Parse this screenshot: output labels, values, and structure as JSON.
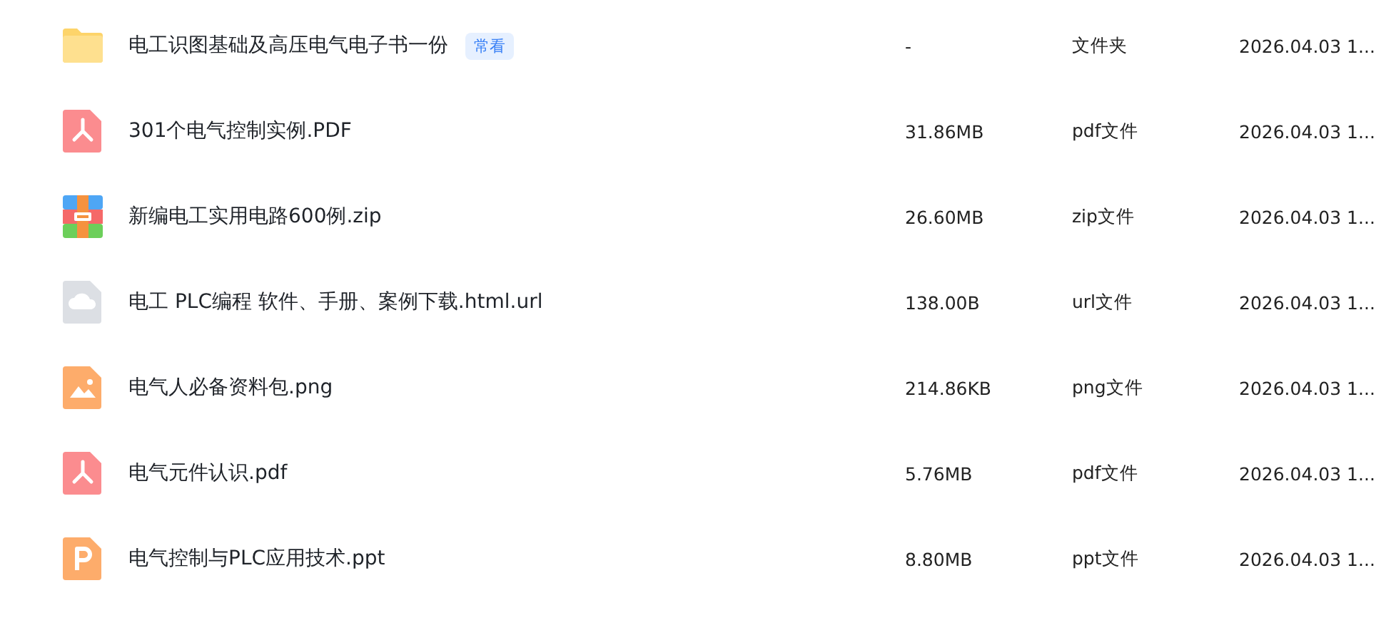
{
  "files": [
    {
      "kind": "folder",
      "name": "电工识图基础及高压电气电子书一份",
      "badge": "常看",
      "size": "-",
      "type": "文件夹",
      "modified": "2026.04.03 1..."
    },
    {
      "kind": "pdf",
      "name": "301个电气控制实例.PDF",
      "size": "31.86MB",
      "type": "pdf文件",
      "modified": "2026.04.03 1..."
    },
    {
      "kind": "zip",
      "name": "新编电工实用电路600例.zip",
      "size": "26.60MB",
      "type": "zip文件",
      "modified": "2026.04.03 1..."
    },
    {
      "kind": "url",
      "name": "电工 PLC编程 软件、手册、案例下载.html.url",
      "size": "138.00B",
      "type": "url文件",
      "modified": "2026.04.03 1..."
    },
    {
      "kind": "image",
      "name": "电气人必备资料包.png",
      "size": "214.86KB",
      "type": "png文件",
      "modified": "2026.04.03 1..."
    },
    {
      "kind": "pdf",
      "name": "电气元件认识.pdf",
      "size": "5.76MB",
      "type": "pdf文件",
      "modified": "2026.04.03 1..."
    },
    {
      "kind": "ppt",
      "name": "电气控制与PLC应用技术.ppt",
      "size": "8.80MB",
      "type": "ppt文件",
      "modified": "2026.04.03 1..."
    }
  ]
}
